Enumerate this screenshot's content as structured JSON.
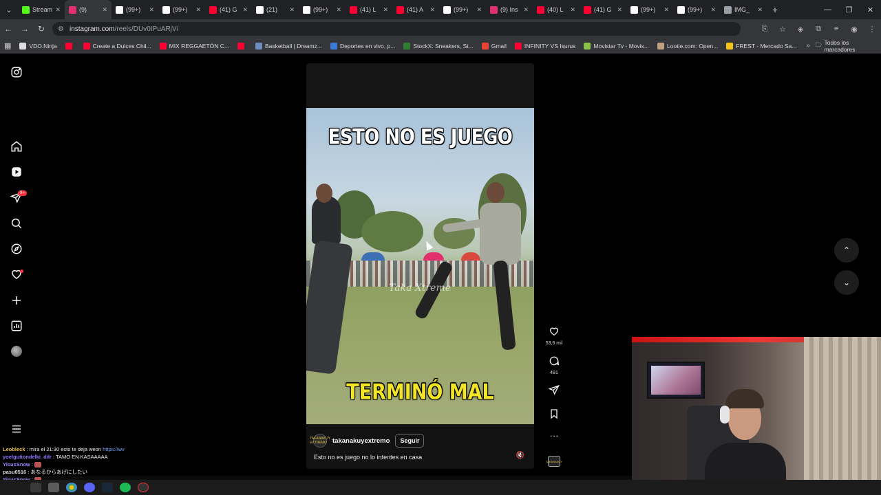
{
  "browser": {
    "tabs": [
      {
        "label": "Stream",
        "color": "#53fc18",
        "active": false
      },
      {
        "label": "(9)",
        "color": "#e1306c",
        "active": true
      },
      {
        "label": "(99+)",
        "color": "#ffffff",
        "active": false
      },
      {
        "label": "(99+)",
        "color": "#ffffff",
        "active": false
      },
      {
        "label": "(41) G",
        "color": "#ff0033",
        "active": false
      },
      {
        "label": "(21)",
        "color": "#ffffff",
        "active": false
      },
      {
        "label": "(99+)",
        "color": "#ffffff",
        "active": false
      },
      {
        "label": "(41) L",
        "color": "#ff0033",
        "active": false
      },
      {
        "label": "(41) A",
        "color": "#ff0033",
        "active": false
      },
      {
        "label": "(99+)",
        "color": "#ffffff",
        "active": false
      },
      {
        "label": "(9) Ins",
        "color": "#e1306c",
        "active": false
      },
      {
        "label": "(40) L",
        "color": "#ff0033",
        "active": false
      },
      {
        "label": "(41) G",
        "color": "#ff0033",
        "active": false
      },
      {
        "label": "(99+)",
        "color": "#ffffff",
        "active": false
      },
      {
        "label": "(99+)",
        "color": "#ffffff",
        "active": false
      },
      {
        "label": "IMG_",
        "color": "#9aa0a6",
        "active": false
      }
    ],
    "url_domain": "instagram.com",
    "url_path": "/reels/DUv0IPuARjV/",
    "bookmarks": [
      {
        "label": "VDO.Ninja",
        "color": "#dddddd"
      },
      {
        "label": "",
        "color": "#ff0033"
      },
      {
        "label": "Create a Dulces Chil...",
        "color": "#ff0033"
      },
      {
        "label": "MIX REGGAETÓN C...",
        "color": "#ff0033"
      },
      {
        "label": "",
        "color": "#ff0033"
      },
      {
        "label": "Basketball | Dreamz...",
        "color": "#6c8ebf"
      },
      {
        "label": "Deportes en vivo, p...",
        "color": "#3a7bd5"
      },
      {
        "label": "StockX: Sneakers, St...",
        "color": "#2e7d32"
      },
      {
        "label": "Gmail",
        "color": "#ea4335"
      },
      {
        "label": "INFINITY VS Isurus",
        "color": "#ff0033"
      },
      {
        "label": "Movistar Tv - Movis...",
        "color": "#8bc34a"
      },
      {
        "label": "Lootie.com: Open...",
        "color": "#c0a080"
      },
      {
        "label": "FREST - Mercado Sa...",
        "color": "#f5c518"
      }
    ],
    "bookmarks_folder": "Todos los marcadores"
  },
  "reel": {
    "caption_top": "ESTO NO ES JUEGO",
    "caption_bottom": "TERMINÓ MAL",
    "watermark": "Taka Xtreme",
    "author": "takanakuyextremo",
    "author_avatar_text": "TAKANAKUY EXTREMO",
    "follow_label": "Seguir",
    "description": "Esto no es juego no lo intentes en casa",
    "likes": "53,6 mil",
    "comments": "491",
    "audio_thumb_text": "TAKANAKUY"
  },
  "chat": [
    {
      "user": "Leobleck",
      "sep": " : ",
      "msg": "mira el 21:30 esto te deja weon ",
      "link": "https://wv"
    },
    {
      "user": "yoelgutiondelki_dilr",
      "sep": " : ",
      "msg": "TAMO EN KASAAAAA",
      "link": ""
    },
    {
      "user": "YisusSnow",
      "sep": " : ",
      "msg": "",
      "link": ""
    },
    {
      "user": "pasu0516",
      "sep": " : ",
      "msg": "あなるからあげにしたい",
      "link": ""
    },
    {
      "user": "YisusSnow",
      "sep": " : ",
      "msg": "",
      "link": ""
    }
  ],
  "colors": {
    "instagram_bg": "#000000",
    "notification_red": "#ff3040",
    "caption_yellow": "#f2e427"
  }
}
